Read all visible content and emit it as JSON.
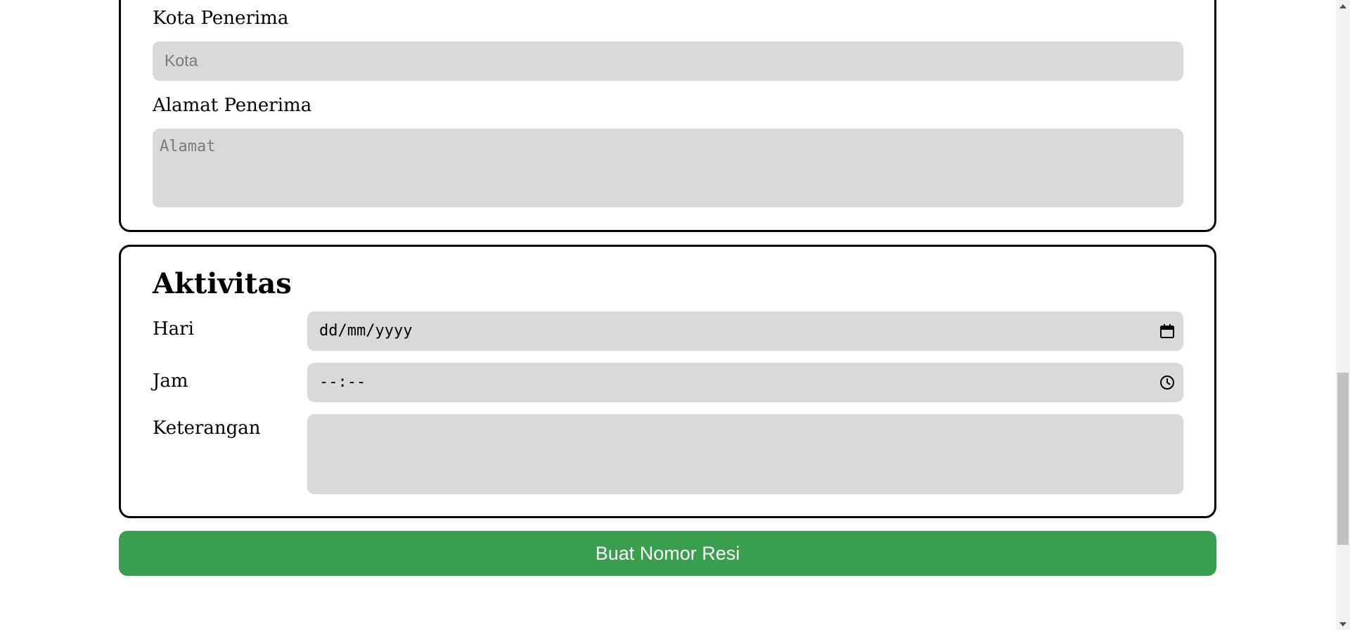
{
  "recipient": {
    "city_label": "Kota Penerima",
    "city_placeholder": "Kota",
    "address_label": "Alamat Penerima",
    "address_placeholder": "Alamat"
  },
  "activity": {
    "heading": "Aktivitas",
    "day_label": "Hari",
    "day_value": "dd/mm/yyyy",
    "time_label": "Jam",
    "time_value": "--:--",
    "note_label": "Keterangan",
    "note_placeholder": ""
  },
  "submit": {
    "label": "Buat Nomor Resi",
    "color": "#3a9e4f"
  },
  "icons": {
    "date": "calendar-icon",
    "time": "clock-icon",
    "scroll_up": "chevron-up-icon",
    "scroll_down": "chevron-down-icon"
  },
  "colors": {
    "field_bg": "#d9d9d9",
    "border": "#000000",
    "placeholder": "#7a7a7a"
  }
}
